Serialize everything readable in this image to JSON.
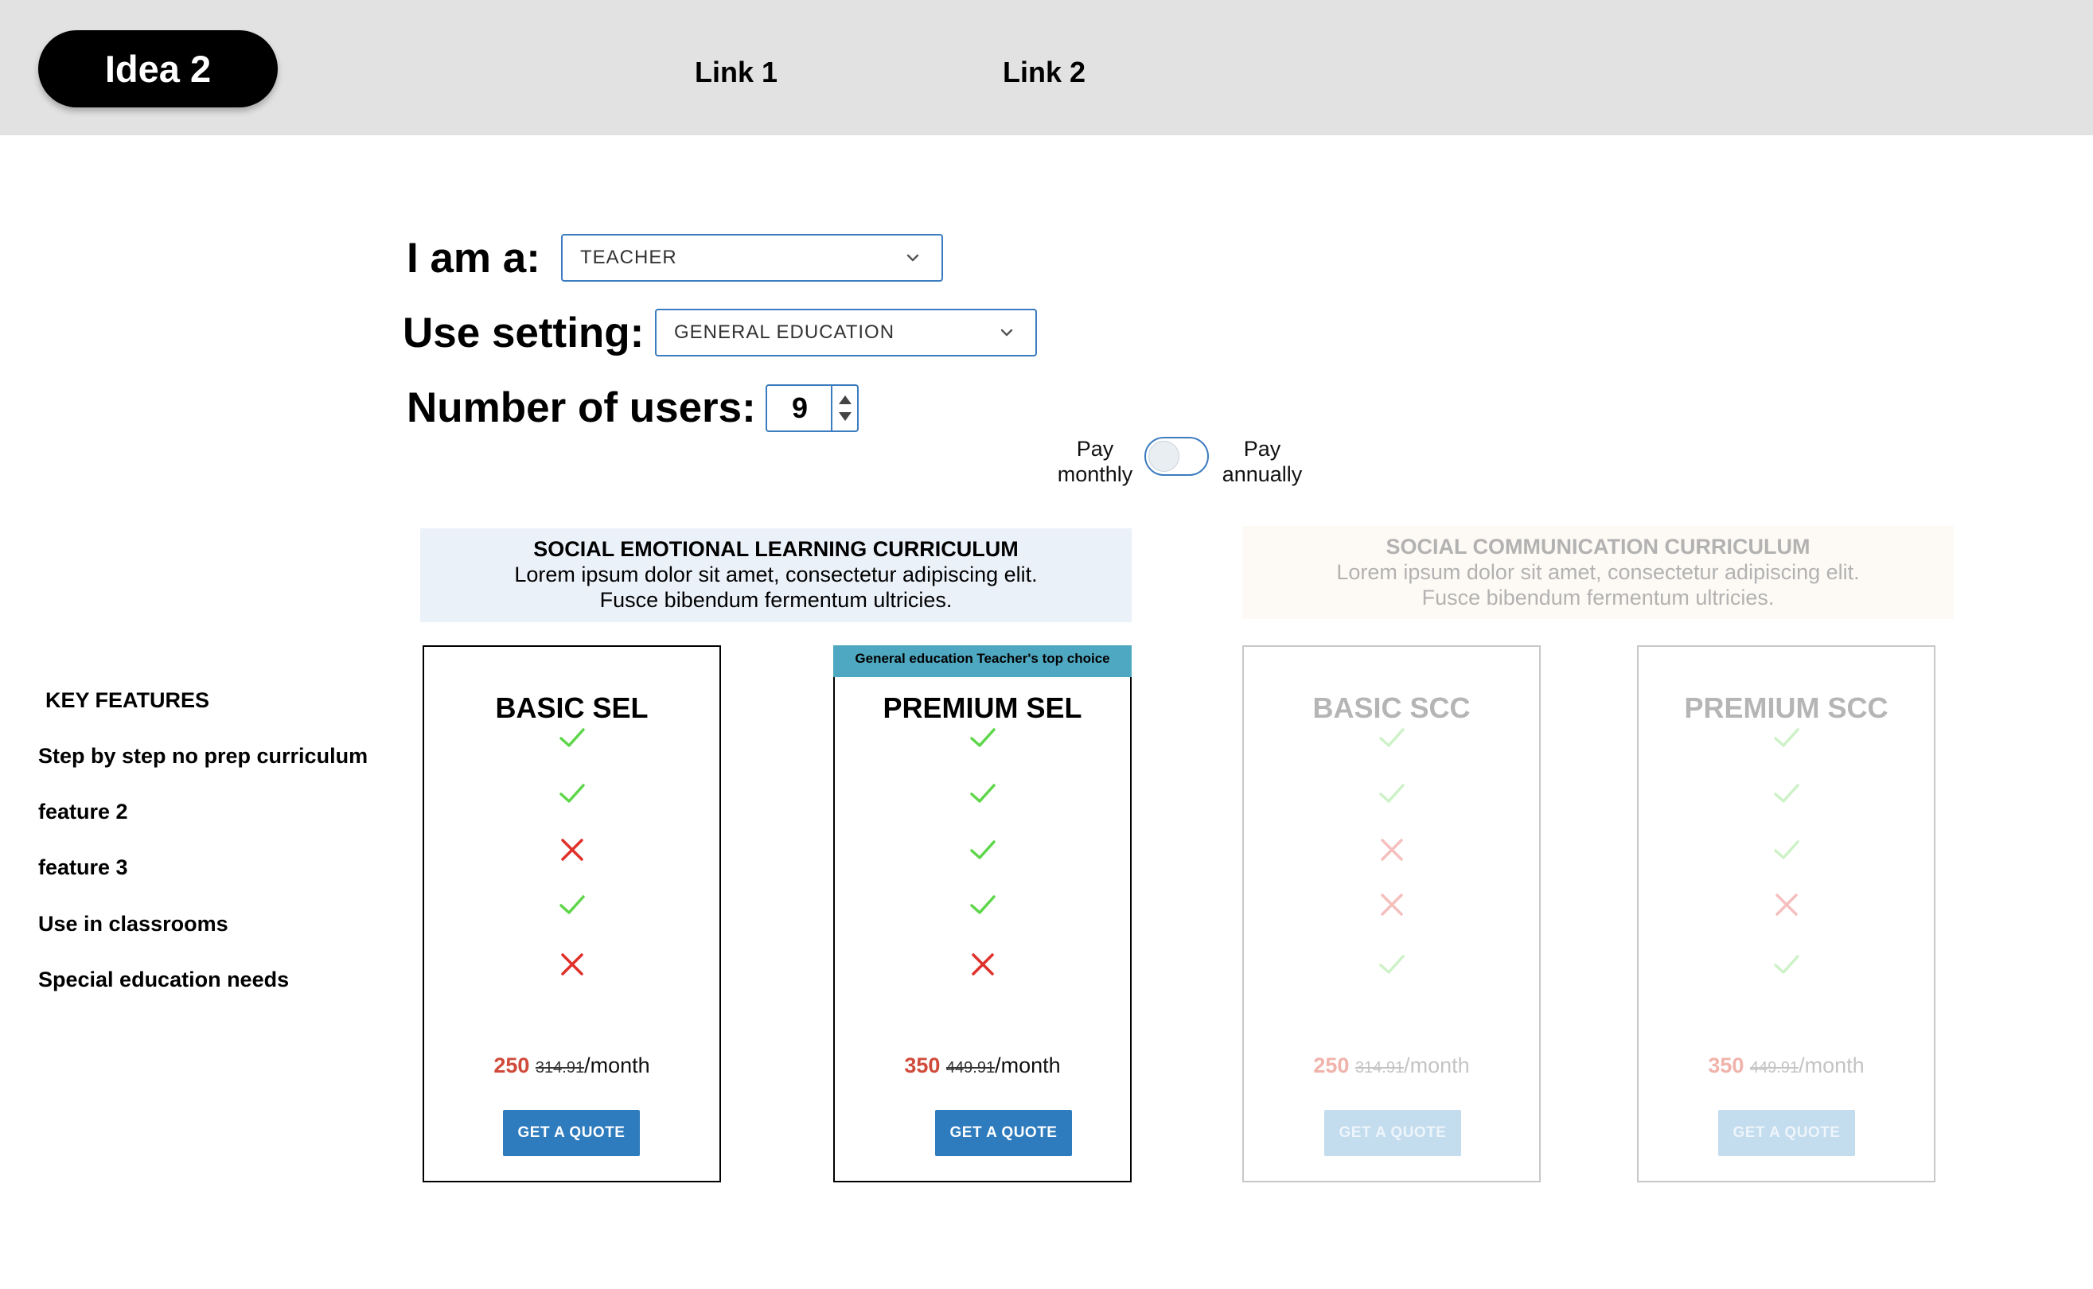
{
  "header": {
    "logo": "Idea 2",
    "links": [
      "Link 1",
      "Link 2"
    ]
  },
  "form": {
    "role_label": "I am a:",
    "role_value": "TEACHER",
    "setting_label": "Use setting:",
    "setting_value": "GENERAL EDUCATION",
    "users_label": "Number of users:",
    "users_value": "9"
  },
  "billing": {
    "monthly_label": "Pay monthly",
    "annually_label": "Pay annually",
    "annual_selected": false
  },
  "curricula": [
    {
      "title": "SOCIAL EMOTIONAL LEARNING CURRICULUM",
      "line1": "Lorem ipsum dolor sit amet, consectetur adipiscing elit.",
      "line2": "Fusce bibendum fermentum ultricies."
    },
    {
      "title": "SOCIAL COMMUNICATION CURRICULUM",
      "line1": "Lorem ipsum dolor sit amet, consectetur adipiscing elit.",
      "line2": "Fusce bibendum fermentum ultricies."
    }
  ],
  "features": {
    "heading": "KEY FEATURES",
    "items": [
      "Step by step no prep curriculum",
      "feature 2",
      "feature 3",
      "Use in classrooms",
      "Special education needs"
    ]
  },
  "plans": [
    {
      "name": "BASIC SEL",
      "badge": "",
      "marks": [
        "check",
        "check",
        "cross",
        "check",
        "cross"
      ],
      "price": "250",
      "old_price": "314.91",
      "period": "/month",
      "cta": "GET A QUOTE",
      "active": true
    },
    {
      "name": "PREMIUM SEL",
      "badge": "General education Teacher's top choice",
      "marks": [
        "check",
        "check",
        "check",
        "check",
        "cross"
      ],
      "price": "350",
      "old_price": "449.91",
      "period": "/month",
      "cta": "GET A QUOTE",
      "active": true
    },
    {
      "name": "BASIC SCC",
      "badge": "",
      "marks": [
        "check",
        "check",
        "cross",
        "cross",
        "check"
      ],
      "price": "250",
      "old_price": "314.91",
      "period": "/month",
      "cta": "GET A QUOTE",
      "active": false
    },
    {
      "name": "PREMIUM SCC",
      "badge": "",
      "marks": [
        "check",
        "check",
        "check",
        "cross",
        "check"
      ],
      "price": "350",
      "old_price": "449.91",
      "period": "/month",
      "cta": "GET A QUOTE",
      "active": false
    }
  ],
  "colors": {
    "check": "#5ed64a",
    "cross": "#e0302a",
    "accent": "#2e7bbd",
    "ribbon": "#4fa8c1",
    "price": "#d04a3a"
  }
}
